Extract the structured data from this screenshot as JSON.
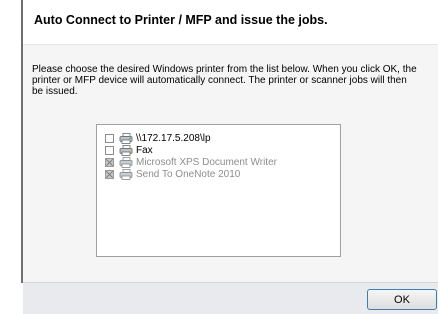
{
  "dialog": {
    "title": "Auto Connect to Printer / MFP and issue the jobs.",
    "instructions": "Please choose the desired Windows printer from the list below. When you click OK, the printer or MFP device will automatically connect. The printer or scanner jobs will then be issued.",
    "ok_label": "OK"
  },
  "printers": [
    {
      "name": "\\\\172.17.5.208\\lp",
      "enabled": true,
      "checked": false,
      "icon": "printer-icon"
    },
    {
      "name": "Fax",
      "enabled": true,
      "checked": false,
      "icon": "fax-printer-icon"
    },
    {
      "name": "Microsoft XPS Document Writer",
      "enabled": false,
      "checked": false,
      "icon": "printer-icon"
    },
    {
      "name": "Send To OneNote 2010",
      "enabled": false,
      "checked": false,
      "icon": "printer-icon"
    }
  ],
  "colors": {
    "disabled_text": "#8d8d8d",
    "button_border": "#3c7fb1",
    "footer_background": "#e9eaee"
  }
}
